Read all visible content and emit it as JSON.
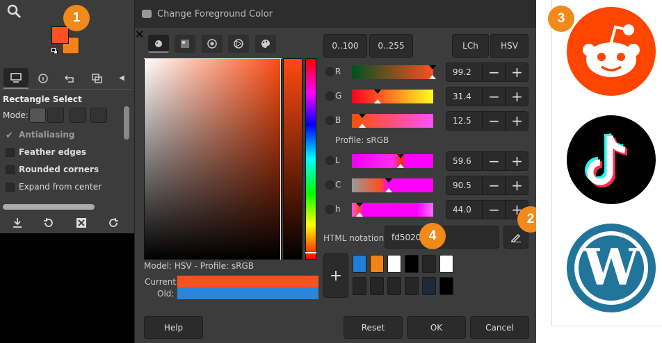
{
  "badges": [
    "1",
    "2",
    "3",
    "4"
  ],
  "toolbox": {
    "tool_title": "Rectangle Select",
    "mode_label": "Mode:",
    "options": [
      {
        "label": "Antialiasing",
        "checked": true,
        "dim": true
      },
      {
        "label": "Feather edges",
        "checked": false,
        "dim": false
      },
      {
        "label": "Rounded corners",
        "checked": false,
        "dim": false
      },
      {
        "label": "Expand from center",
        "checked": false,
        "dim": false
      }
    ],
    "fg_color": "#fd5020",
    "bg_color": "#f28314"
  },
  "dialog": {
    "title": "Change Foreground Color",
    "range_buttons": [
      "0..100",
      "0..255"
    ],
    "space_buttons": [
      "LCh",
      "HSV"
    ],
    "channels": [
      {
        "label": "R",
        "value": "99.2",
        "pos": 0.992
      },
      {
        "label": "G",
        "value": "31.4",
        "pos": 0.314
      },
      {
        "label": "B",
        "value": "12.5",
        "pos": 0.125
      },
      {
        "label": "L",
        "value": "59.6",
        "pos": 0.596
      },
      {
        "label": "C",
        "value": "90.5",
        "pos": 0.45
      },
      {
        "label": "h",
        "value": "44.0",
        "pos": 0.09
      }
    ],
    "profile_label": "Profile: sRGB",
    "html_label": "HTML notation:",
    "html_value": "fd5020",
    "model_label": "Model: HSV - Profile: sRGB",
    "current_label": "Current:",
    "old_label": "Old:",
    "current_color": "#fd5020",
    "old_color": "#2a86d8",
    "history_colors": [
      "#1e7fd6",
      "#f28314",
      "#ffffff",
      "#000000",
      "#262626",
      "#ffffff",
      "#262626",
      "#262626",
      "#262626",
      "#262626",
      "#1e2a3a",
      "#000000"
    ],
    "buttons": {
      "help": "Help",
      "reset": "Reset",
      "ok": "OK",
      "cancel": "Cancel"
    }
  }
}
